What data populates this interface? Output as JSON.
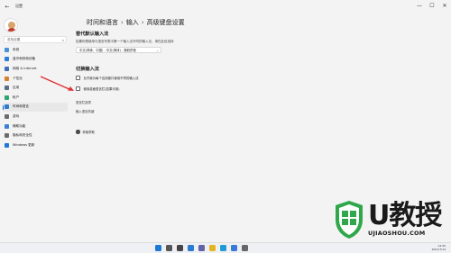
{
  "window": {
    "app_title": "设置",
    "back_glyph": "←",
    "controls": [
      "—",
      "☐",
      "✕"
    ]
  },
  "sidebar": {
    "search_placeholder": "查找设置",
    "items": [
      {
        "label": "系统",
        "icon": "system-icon",
        "color": "#4a90d9"
      },
      {
        "label": "蓝牙和其他设备",
        "icon": "bluetooth-icon",
        "color": "#2f7dd6"
      },
      {
        "label": "网络 & Internet",
        "icon": "network-icon",
        "color": "#3d6fb5"
      },
      {
        "label": "个性化",
        "icon": "brush-icon",
        "color": "#d97f2f"
      },
      {
        "label": "应用",
        "icon": "apps-icon",
        "color": "#5a6c89"
      },
      {
        "label": "帐户",
        "icon": "account-icon",
        "color": "#2fa66d"
      },
      {
        "label": "时间和语言",
        "icon": "time-language-icon",
        "color": "#2b7bd1",
        "active": true
      },
      {
        "label": "游戏",
        "icon": "gaming-icon",
        "color": "#6b6b6b"
      },
      {
        "label": "辅助功能",
        "icon": "accessibility-icon",
        "color": "#3c7fd4"
      },
      {
        "label": "隐私和安全性",
        "icon": "shield-icon",
        "color": "#6b6b6b"
      },
      {
        "label": "Windows 更新",
        "icon": "update-icon",
        "color": "#1e78d6"
      }
    ]
  },
  "content": {
    "breadcrumb": [
      "时间和语言",
      "输入",
      "高级键盘设置"
    ],
    "override_title": "替代默认输入法",
    "override_desc": "如果你想使用与语言列表中第一个输入法不同的输入法，请在此处选择",
    "dropdown_value": "中文(简体，中国) - 中文(简体) - 微软拼音",
    "switch_title": "切换输入法",
    "checkbox_per_app": "允许我为每个应用窗口使用不同的输入法",
    "checkbox_desktop_bar": "使用桌面语言栏(如果可用)",
    "link_hotkeys": "语言栏选项",
    "link_input_hotkeys": "输入语言热键",
    "help_label": "获取帮助"
  },
  "watermark": {
    "main": "U教授",
    "url": "UJIAOSHOU.COM",
    "colors": {
      "green": "#2fa74a",
      "dark": "#1a1a1a"
    }
  },
  "taskbar": {
    "icons": [
      {
        "name": "start-icon",
        "color": "#1e78d6"
      },
      {
        "name": "search-icon",
        "color": "#555555"
      },
      {
        "name": "task-view-icon",
        "color": "#444444"
      },
      {
        "name": "widgets-icon",
        "color": "#2b7bd1"
      },
      {
        "name": "chat-icon",
        "color": "#6264a7"
      },
      {
        "name": "file-explorer-icon",
        "color": "#e6b422"
      },
      {
        "name": "edge-icon",
        "color": "#1e9ad6"
      },
      {
        "name": "store-icon",
        "color": "#3a79d6"
      },
      {
        "name": "settings-icon",
        "color": "#666666"
      }
    ],
    "time": "14:45",
    "date": "2021/7/14"
  }
}
